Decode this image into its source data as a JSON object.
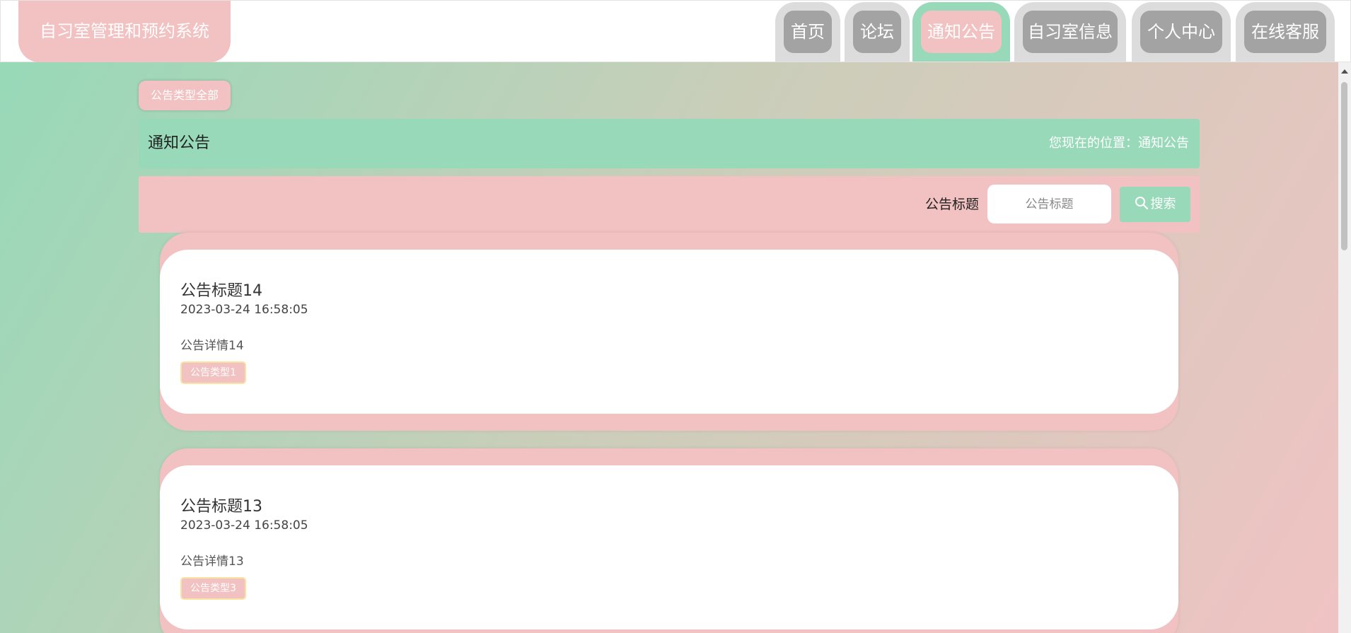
{
  "header": {
    "brand": "自习室管理和预约系统"
  },
  "nav": {
    "items": [
      {
        "label": "首页",
        "active": false
      },
      {
        "label": "论坛",
        "active": false
      },
      {
        "label": "通知公告",
        "active": true
      },
      {
        "label": "自习室信息",
        "active": false
      },
      {
        "label": "个人中心",
        "active": false
      },
      {
        "label": "在线客服",
        "active": false
      }
    ]
  },
  "filter": {
    "type_all_label": "公告类型全部"
  },
  "titlebar": {
    "title": "通知公告",
    "location": "您现在的位置：通知公告"
  },
  "search": {
    "label": "公告标题",
    "placeholder": "公告标题",
    "button_label": "搜索",
    "icon": "search-icon"
  },
  "notices": [
    {
      "title": "公告标题14",
      "time": "2023-03-24 16:58:05",
      "detail": "公告详情14",
      "type": "公告类型1"
    },
    {
      "title": "公告标题13",
      "time": "2023-03-24 16:58:05",
      "detail": "公告详情13",
      "type": "公告类型3"
    }
  ],
  "colors": {
    "green": "#97d9b8",
    "pink": "#f2c1c1",
    "gray_tab": "#a3a3a3"
  }
}
